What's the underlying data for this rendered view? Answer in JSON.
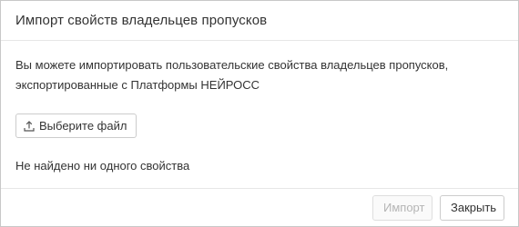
{
  "dialog": {
    "title": "Импорт свойств владельцев пропусков",
    "description_line1": "Вы можете импортировать пользовательские свойства владельцев пропусков,",
    "description_line2": "экспортированные с Платформы НЕЙРОСС",
    "choose_file_label": "Выберите файл",
    "status_text": "Не найдено ни одного свойства",
    "import_label": "Импорт",
    "close_label": "Закрыть",
    "import_enabled": false
  },
  "icons": {
    "choose_file": "upload-icon"
  },
  "colors": {
    "text": "#333333",
    "border": "#cccccc",
    "disabled_text": "#b5b5b5",
    "divider": "#e6e6e6"
  }
}
